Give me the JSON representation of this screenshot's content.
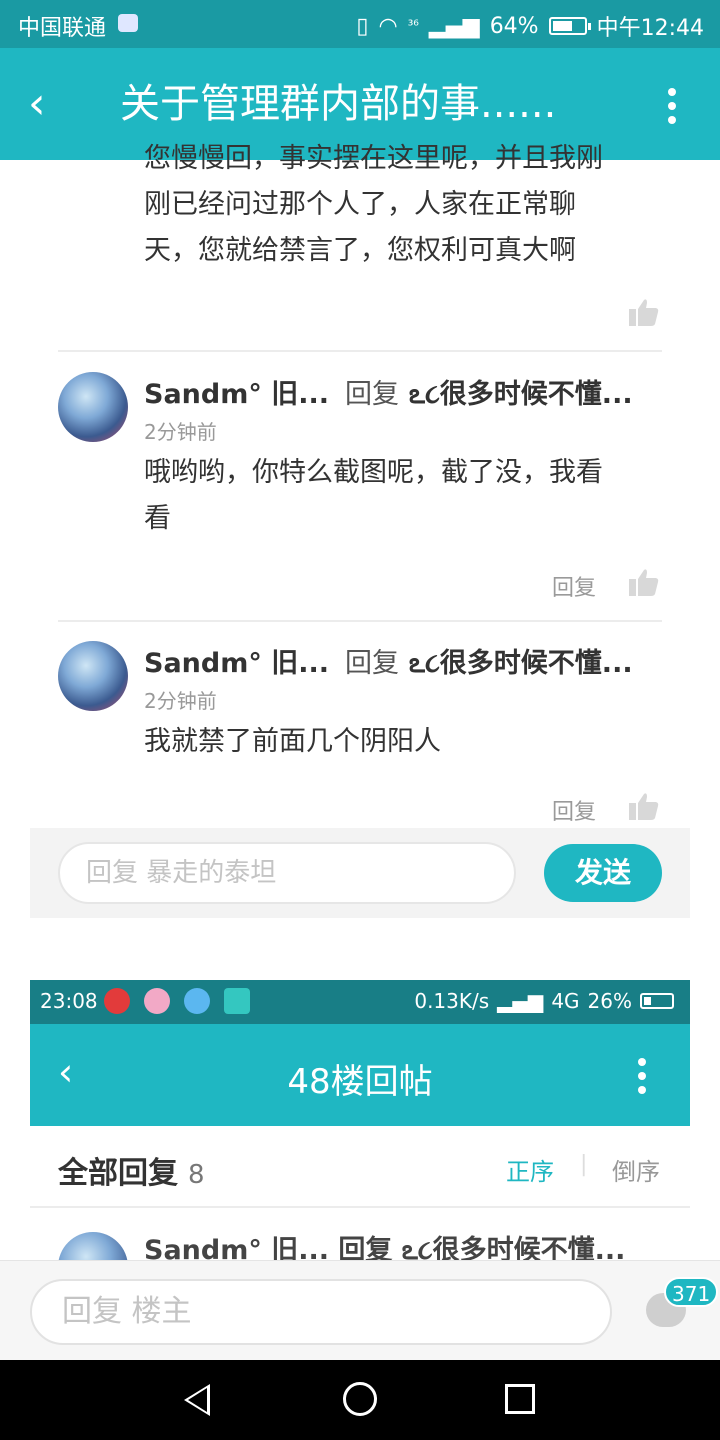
{
  "status_bar": {
    "carrier": "中国联通",
    "signal": "³⁶",
    "battery": "64%",
    "battery_level": 0.64,
    "time": "中午12:44"
  },
  "app_bar": {
    "back_icon": "chevron-left-icon",
    "title": "关于管理群内部的事......",
    "menu_icon": "more-vert-icon"
  },
  "comments": [
    {
      "text_lines": [
        "您慢慢回，事实摆在这里呢，并且我刚",
        "刚已经问过那个人了，人家在正常聊",
        "天，您就给禁言了，您权利可真大啊"
      ]
    },
    {
      "author": "Sandm° 旧...",
      "reply_label": "回复",
      "target": "ఽ૮很多时候不懂...",
      "time": "2分钟前",
      "text_lines": [
        "哦哟哟，你特么截图呢，截了没，我看",
        "看"
      ],
      "reply_link": "回复"
    },
    {
      "author": "Sandm° 旧...",
      "reply_label": "回复",
      "target": "ఽ૮很多时候不懂...",
      "time": "2分钟前",
      "text_lines": [
        "我就禁了前面几个阴阳人"
      ],
      "reply_link": "回复"
    }
  ],
  "reply_box": {
    "placeholder": "回复 暴走的泰坦",
    "send_label": "发送"
  },
  "screenshot2": {
    "status": {
      "time": "23:08",
      "net_speed": "0.13K/s",
      "signal": "4G",
      "battery": "26%",
      "battery_level": 0.26
    },
    "title": "48楼回帖",
    "all_replies_label": "全部回复",
    "reply_count": "8",
    "sort_asc": "正序",
    "sort_sep": "|",
    "sort_desc": "倒序",
    "peek_text": "Sandm° 旧...  回复  ఽ૮很多时候不懂..."
  },
  "bottom_bar": {
    "placeholder": "回复  楼主",
    "badge_count": "371"
  },
  "colors": {
    "accent": "#1fb7c2",
    "status_bar": "#1a9aa3"
  }
}
